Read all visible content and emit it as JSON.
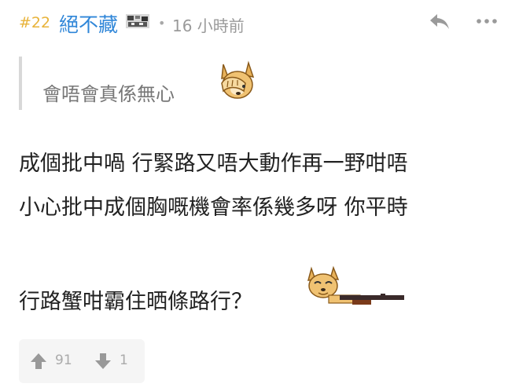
{
  "post": {
    "floor": "#22",
    "username": "絕不藏",
    "separator": "•",
    "timestamp": "16 小時前"
  },
  "quote": {
    "text": "會唔會真係無心"
  },
  "content": {
    "line1": "成個批中喎 行緊路又唔大動作再一野咁唔",
    "line2": "小心批中成個胸嘅機會率係幾多呀 你平時",
    "line3": "行路蟹咁霸住晒條路行？"
  },
  "votes": {
    "up": "91",
    "down": "1"
  },
  "colors": {
    "floor": "#e8b33a",
    "username": "#2f86d8",
    "meta": "#9a9a9a",
    "text": "#222222",
    "quote": "#777777"
  },
  "icons": {
    "reply": "reply-icon",
    "more": "more-icon",
    "up": "arrow-up-icon",
    "down": "arrow-down-icon"
  }
}
